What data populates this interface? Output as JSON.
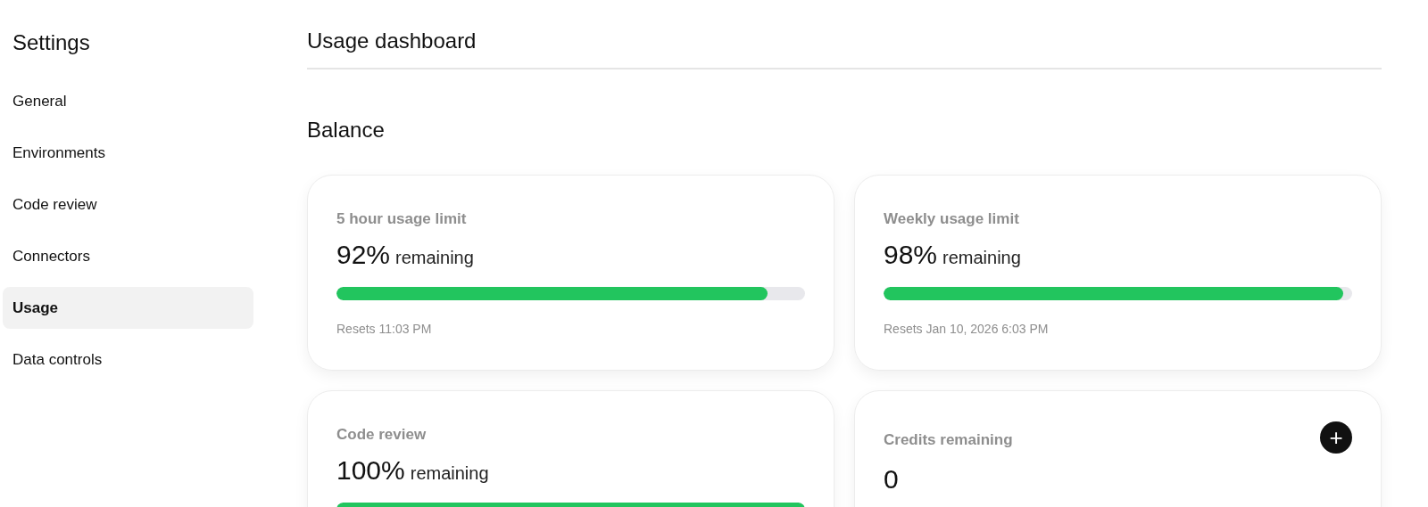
{
  "sidebar": {
    "title": "Settings",
    "items": [
      {
        "label": "General",
        "selected": false
      },
      {
        "label": "Environments",
        "selected": false
      },
      {
        "label": "Code review",
        "selected": false
      },
      {
        "label": "Connectors",
        "selected": false
      },
      {
        "label": "Usage",
        "selected": true
      },
      {
        "label": "Data controls",
        "selected": false
      }
    ]
  },
  "main": {
    "title": "Usage dashboard",
    "section": "Balance",
    "cards": [
      {
        "kind": "meter",
        "label": "5 hour usage limit",
        "value": "92%",
        "suffix": "remaining",
        "level": 0.92,
        "note": "Resets 11:03 PM"
      },
      {
        "kind": "meter",
        "label": "Weekly usage limit",
        "value": "98%",
        "suffix": "remaining",
        "level": 0.98,
        "note": "Resets Jan 10, 2026 6:03 PM"
      },
      {
        "kind": "meter",
        "label": "Code review",
        "value": "100%",
        "suffix": "remaining",
        "level": 1
      },
      {
        "kind": "credits",
        "label": "Credits remaining",
        "value": "0",
        "button": "+"
      }
    ]
  }
}
